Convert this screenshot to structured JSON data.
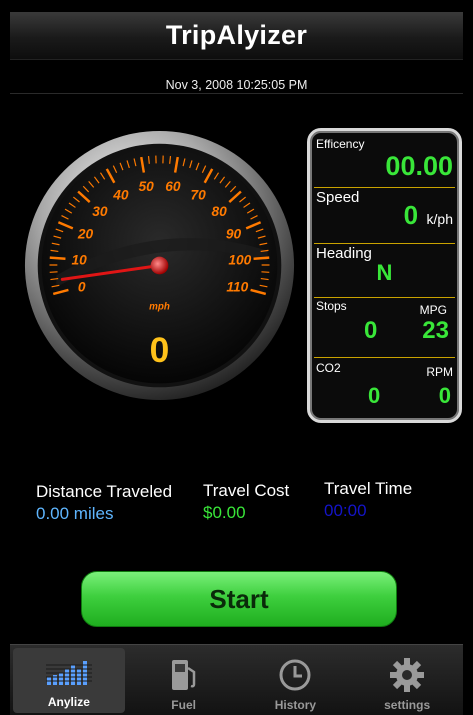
{
  "app": {
    "title": "TripAlyizer"
  },
  "header": {
    "datetime": "Nov 3, 2008 10:25:05 PM"
  },
  "gauge": {
    "unit": "mph",
    "speed": "0",
    "ticks": [
      "0",
      "10",
      "20",
      "30",
      "40",
      "50",
      "60",
      "70",
      "80",
      "90",
      "100",
      "110"
    ],
    "accent": "#ff7a00",
    "needle_color": "#e01515"
  },
  "panel": {
    "efficiency": {
      "label": "Efficency",
      "value": "00.00"
    },
    "speed": {
      "label": "Speed",
      "value": "0",
      "unit": "k/ph"
    },
    "heading": {
      "label": "Heading",
      "value": "N"
    },
    "stops": {
      "label": "Stops",
      "value": "0"
    },
    "mpg": {
      "label": "MPG",
      "value": "23"
    },
    "co2": {
      "label": "CO2",
      "value": "0"
    },
    "rpm": {
      "label": "RPM",
      "value": "0"
    }
  },
  "summary": {
    "distance": {
      "label": "Distance Traveled",
      "value": "0.00 miles",
      "color": "#5fb6ff"
    },
    "cost": {
      "label": "Travel Cost",
      "value": "$0.00",
      "color": "#39e639"
    },
    "time": {
      "label": "Travel Time",
      "value": "00:00",
      "color": "#1414c8"
    }
  },
  "actions": {
    "start_label": "Start"
  },
  "tabs": [
    {
      "label": "Anylize",
      "icon": "equalizer-icon"
    },
    {
      "label": "Fuel",
      "icon": "fuel-pump-icon"
    },
    {
      "label": "History",
      "icon": "clock-icon"
    },
    {
      "label": "settings",
      "icon": "gear-icon"
    }
  ]
}
